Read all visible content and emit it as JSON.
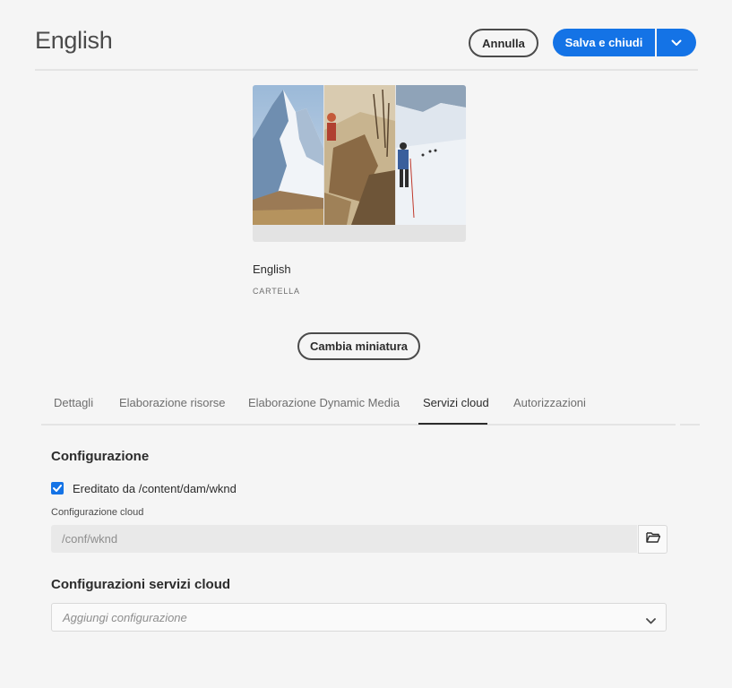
{
  "header": {
    "title": "English",
    "cancel_label": "Annulla",
    "save_label": "Salva e chiudi"
  },
  "thumbnail": {
    "name": "English",
    "type": "CARTELLA",
    "change_label": "Cambia miniatura"
  },
  "tabs": [
    {
      "label": "Dettagli"
    },
    {
      "label": "Elaborazione risorse"
    },
    {
      "label": "Elaborazione Dynamic Media"
    },
    {
      "label": "Servizi cloud"
    },
    {
      "label": "Autorizzazioni"
    }
  ],
  "active_tab": "Servizi cloud",
  "config": {
    "title": "Configurazione",
    "inherit_label": "Ereditato da /content/dam/wknd",
    "inherit_checked": true,
    "field_label": "Configurazione cloud",
    "field_value": "/conf/wknd"
  },
  "services": {
    "title": "Configurazioni servizi cloud",
    "placeholder": "Aggiungi configurazione"
  },
  "colors": {
    "accent": "#1473e6"
  },
  "icons": {
    "save_menu": "chevron-down-icon",
    "browse": "folder-icon",
    "select": "chevron-down-icon",
    "checkbox": "checkmark-icon"
  }
}
